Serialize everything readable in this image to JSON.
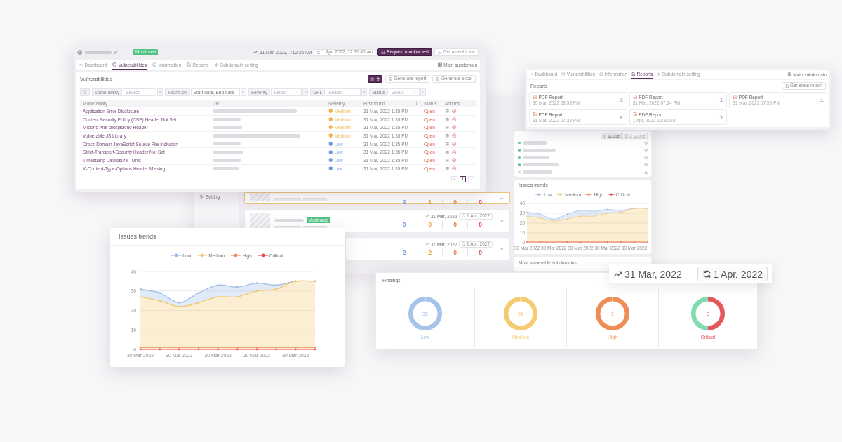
{
  "main_panel": {
    "header": {
      "status_badge": "Monitored",
      "last_scan": "31 Mar, 2022, 7:12:26 AM",
      "next_scan": "1 Apr, 2022, 12:30:46 am",
      "buttons": [
        {
          "label": "Request monitor test",
          "kind": "primary"
        },
        {
          "label": "Get a certificate",
          "kind": "outline"
        }
      ]
    },
    "tabs": [
      {
        "label": "Dashboard",
        "selected": false
      },
      {
        "label": "Vulnerabilities",
        "selected": true
      },
      {
        "label": "Information",
        "selected": false
      },
      {
        "label": "Reports",
        "selected": false
      },
      {
        "label": "Subdomain setting",
        "selected": false
      }
    ],
    "main_subdomain": "Main subdomain",
    "card_title": "Vulnerabilities",
    "card_buttons": [
      "Generate report",
      "Generate excel"
    ],
    "filters": [
      {
        "label": "Vulnerability",
        "kind": "text",
        "placeholder": "Search"
      },
      {
        "label": "Found on",
        "kind": "date",
        "placeholder": "Start date, End date"
      },
      {
        "label": "Severity",
        "kind": "select",
        "placeholder": "Select"
      },
      {
        "label": "URL",
        "kind": "text",
        "placeholder": "Search"
      },
      {
        "label": "Status",
        "kind": "select",
        "placeholder": "Select"
      }
    ],
    "columns": [
      "Vulnerability",
      "URL",
      "Severity",
      "First found",
      "Status",
      "Actions"
    ],
    "rows": [
      {
        "vulnerability": "Application Error Disclosure",
        "severity": {
          "label": "Medium",
          "color": "#f0b34f"
        },
        "first_found": "31 Mar, 2022 1:35 PM",
        "status": "Open"
      },
      {
        "vulnerability": "Content Security Policy (CSP) Header Not Set",
        "severity": {
          "label": "Medium",
          "color": "#f0b34f"
        },
        "first_found": "31 Mar, 2022 1:35 PM",
        "status": "Open"
      },
      {
        "vulnerability": "Missing Anti-clickjacking Header",
        "severity": {
          "label": "Medium",
          "color": "#f0b34f"
        },
        "first_found": "31 Mar, 2022 1:35 PM",
        "status": "Open"
      },
      {
        "vulnerability": "Vulnerable JS Library",
        "severity": {
          "label": "Medium",
          "color": "#f0b34f"
        },
        "first_found": "31 Mar, 2022 1:35 PM",
        "status": "Open"
      },
      {
        "vulnerability": "Cross-Domain JavaScript Source File Inclusion",
        "severity": {
          "label": "Low",
          "color": "#6f9be0"
        },
        "first_found": "31 Mar, 2022 1:35 PM",
        "status": "Open"
      },
      {
        "vulnerability": "Strict-Transport-Security Header Not Set",
        "severity": {
          "label": "Low",
          "color": "#6f9be0"
        },
        "first_found": "31 Mar, 2022 1:35 PM",
        "status": "Open"
      },
      {
        "vulnerability": "Timestamp Disclosure - Unix",
        "severity": {
          "label": "Low",
          "color": "#6f9be0"
        },
        "first_found": "31 Mar, 2022 1:35 PM",
        "status": "Open"
      },
      {
        "vulnerability": "X-Content-Type-Options Header Missing",
        "severity": {
          "label": "Low",
          "color": "#6f9be0"
        },
        "first_found": "31 Mar, 2022 1:35 PM",
        "status": "Open"
      }
    ],
    "pagination": [
      {
        "label": "1",
        "selected": true
      }
    ]
  },
  "reports_panel": {
    "tabs": [
      {
        "label": "Dashboard",
        "selected": false
      },
      {
        "label": "Vulnerabilities",
        "selected": false
      },
      {
        "label": "Information",
        "selected": false
      },
      {
        "label": "Reports",
        "selected": true
      },
      {
        "label": "Subdomain setting",
        "selected": false
      }
    ],
    "main_subdomain": "Main subdomain",
    "card_title": "Reports",
    "button": "Generate report",
    "reports": [
      {
        "title": "PDF Report",
        "date": "30 Mar, 2022 08:58 PM"
      },
      {
        "title": "PDF Report",
        "date": "31 Mar, 2022 07:24 PM"
      },
      {
        "title": "PDF Report",
        "date": "31 Mar, 2022 07:50 PM"
      },
      {
        "title": "PDF Report",
        "date": "31 Mar, 2022 07:38 PM"
      },
      {
        "title": "PDF Report",
        "date": "1 Apr, 2022 12:32 AM"
      }
    ]
  },
  "background_dashboard": {
    "sidebar_item": "Setting",
    "subdomains": [
      {
        "kind": "tags",
        "selected": true,
        "counts": [
          {
            "value": "2",
            "color": "#6f9be0"
          },
          {
            "value": "1",
            "color": "#e2a033"
          },
          {
            "value": "0",
            "color": "#ee7d47"
          },
          {
            "value": "0",
            "color": "#e24d4d"
          }
        ]
      },
      {
        "kind": "full",
        "selected": false,
        "badge": "Monitored",
        "last_scan": "31 Mar, 2022",
        "next_scan": "1 Apr, 2022",
        "counts": [
          {
            "value": "0",
            "color": "#6f9be0"
          },
          {
            "value": "0",
            "color": "#e2a033"
          },
          {
            "value": "0",
            "color": "#ee7d47"
          },
          {
            "value": "0",
            "color": "#e24d4d"
          }
        ]
      },
      {
        "kind": "stats",
        "selected": false,
        "last_scan": "31 Mar, 2022",
        "next_scan": "1 Apr, 2022",
        "counts": [
          {
            "value": "2",
            "color": "#6f9be0"
          },
          {
            "value": "2",
            "color": "#e2a033"
          },
          {
            "value": "0",
            "color": "#ee7d47"
          },
          {
            "value": "0",
            "color": "#e24d4d"
          }
        ]
      }
    ],
    "scope_tabs": [
      {
        "label": "In scope",
        "selected": true
      },
      {
        "label": "Out scope",
        "selected": false
      }
    ],
    "watch_list": [
      {
        "kind": "eye",
        "color": "#5ccb90"
      },
      {
        "kind": "eye",
        "color": "#5ccb90"
      },
      {
        "kind": "eye",
        "color": "#5ccb90"
      },
      {
        "kind": "eye",
        "color": "#5ccb90"
      },
      {
        "kind": "warning",
        "color": "#b4e4c9"
      }
    ],
    "issues_trends": {
      "chart_data": {
        "type": "area",
        "title": "Issues trends",
        "categories": [
          "30 Mar 2022",
          null,
          "30 Mar 2022",
          null,
          "30 Mar 2022",
          null,
          "30 Mar 2022",
          null,
          "30 Mar 2022",
          null
        ],
        "series": [
          {
            "name": "Low",
            "type": "area",
            "color": "#9dbbe6",
            "values": [
              31,
              29,
              24,
              29,
              33,
              32,
              34,
              33,
              35,
              35
            ]
          },
          {
            "name": "Medium",
            "type": "area",
            "color": "#f5c66d",
            "values": [
              27,
              25,
              22,
              24,
              27,
              27,
              30,
              31,
              35,
              35
            ]
          },
          {
            "name": "High",
            "type": "line",
            "color": "#ef8a52",
            "values": [
              1,
              1,
              1,
              1,
              1,
              1,
              1,
              1,
              1,
              1
            ]
          },
          {
            "name": "Critical",
            "type": "line",
            "color": "#e5484d",
            "values": [
              0,
              0,
              0,
              0,
              0,
              0,
              0,
              0,
              0,
              0
            ]
          }
        ],
        "ylim": [
          0,
          40
        ],
        "yticks": [
          0,
          10,
          20,
          30,
          40
        ],
        "grid": true
      }
    },
    "most_vulnerable_title": "Most vulnerable subdomains"
  },
  "trends_panel": {
    "chart_data": {
      "type": "area",
      "title": "Issues trends",
      "categories": [
        "30 Mar 2022",
        null,
        "30 Mar 2022",
        null,
        "30 Mar 2022",
        null,
        "30 Mar 2022",
        null,
        "30 Mar 2022",
        null
      ],
      "series": [
        {
          "name": "Low",
          "type": "area",
          "color": "#9dbbe6",
          "values": [
            31,
            29,
            24,
            29,
            33,
            32,
            34,
            33,
            35,
            35
          ]
        },
        {
          "name": "Medium",
          "type": "area",
          "color": "#f5c66d",
          "values": [
            27,
            25,
            22,
            24,
            27,
            27,
            30,
            31,
            35,
            35
          ]
        },
        {
          "name": "High",
          "type": "line",
          "color": "#ef8a52",
          "values": [
            1,
            1,
            1,
            1,
            1,
            1,
            1,
            1,
            1,
            1
          ]
        },
        {
          "name": "Critical",
          "type": "line",
          "color": "#e5484d",
          "values": [
            0,
            0,
            0,
            0,
            0,
            0,
            0,
            0,
            0,
            0
          ]
        }
      ],
      "ylim": [
        0,
        40
      ],
      "yticks": [
        0,
        10,
        20,
        30,
        40
      ],
      "grid": true
    }
  },
  "findings_panel": {
    "title": "Findings",
    "items": [
      {
        "label": "Low",
        "value": "35",
        "color": "#a8c3ea",
        "kind": "full"
      },
      {
        "label": "Medium",
        "value": "35",
        "color": "#f5cb72",
        "kind": "full"
      },
      {
        "label": "High",
        "value": "1",
        "color": "#ee8d58",
        "kind": "full"
      },
      {
        "label": "Critical",
        "value": "0",
        "color": "#e4585c",
        "kind": "split"
      }
    ]
  },
  "scan_dates": {
    "last_scan": "31 Mar, 2022",
    "next_scan": "1 Apr, 2022"
  }
}
